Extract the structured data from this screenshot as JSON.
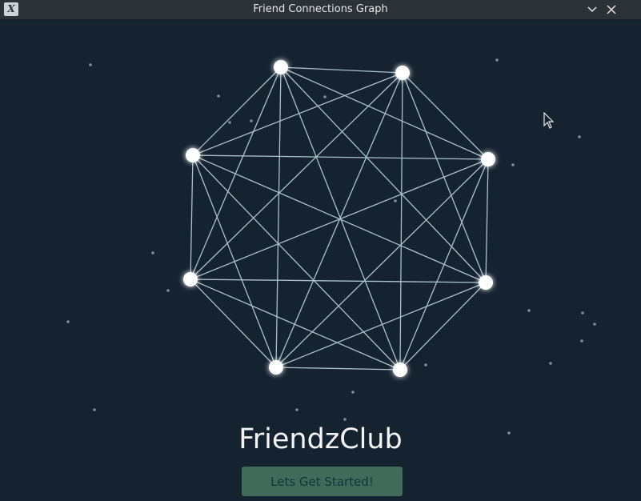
{
  "window": {
    "title": "Friend Connections Graph",
    "icon": "x-app-icon",
    "controls": [
      "minimize-icon",
      "close-icon"
    ]
  },
  "app": {
    "brand": "FriendzClub",
    "cta_label": "Lets Get Started!"
  },
  "graph": {
    "node_count": 8,
    "edges": "complete"
  },
  "colors": {
    "background": "#152230",
    "titlebar": "#2d3237",
    "edge": "#a9c3cc",
    "node": "#ffffff",
    "button": "#3f6b58",
    "button_text": "#12343a"
  }
}
